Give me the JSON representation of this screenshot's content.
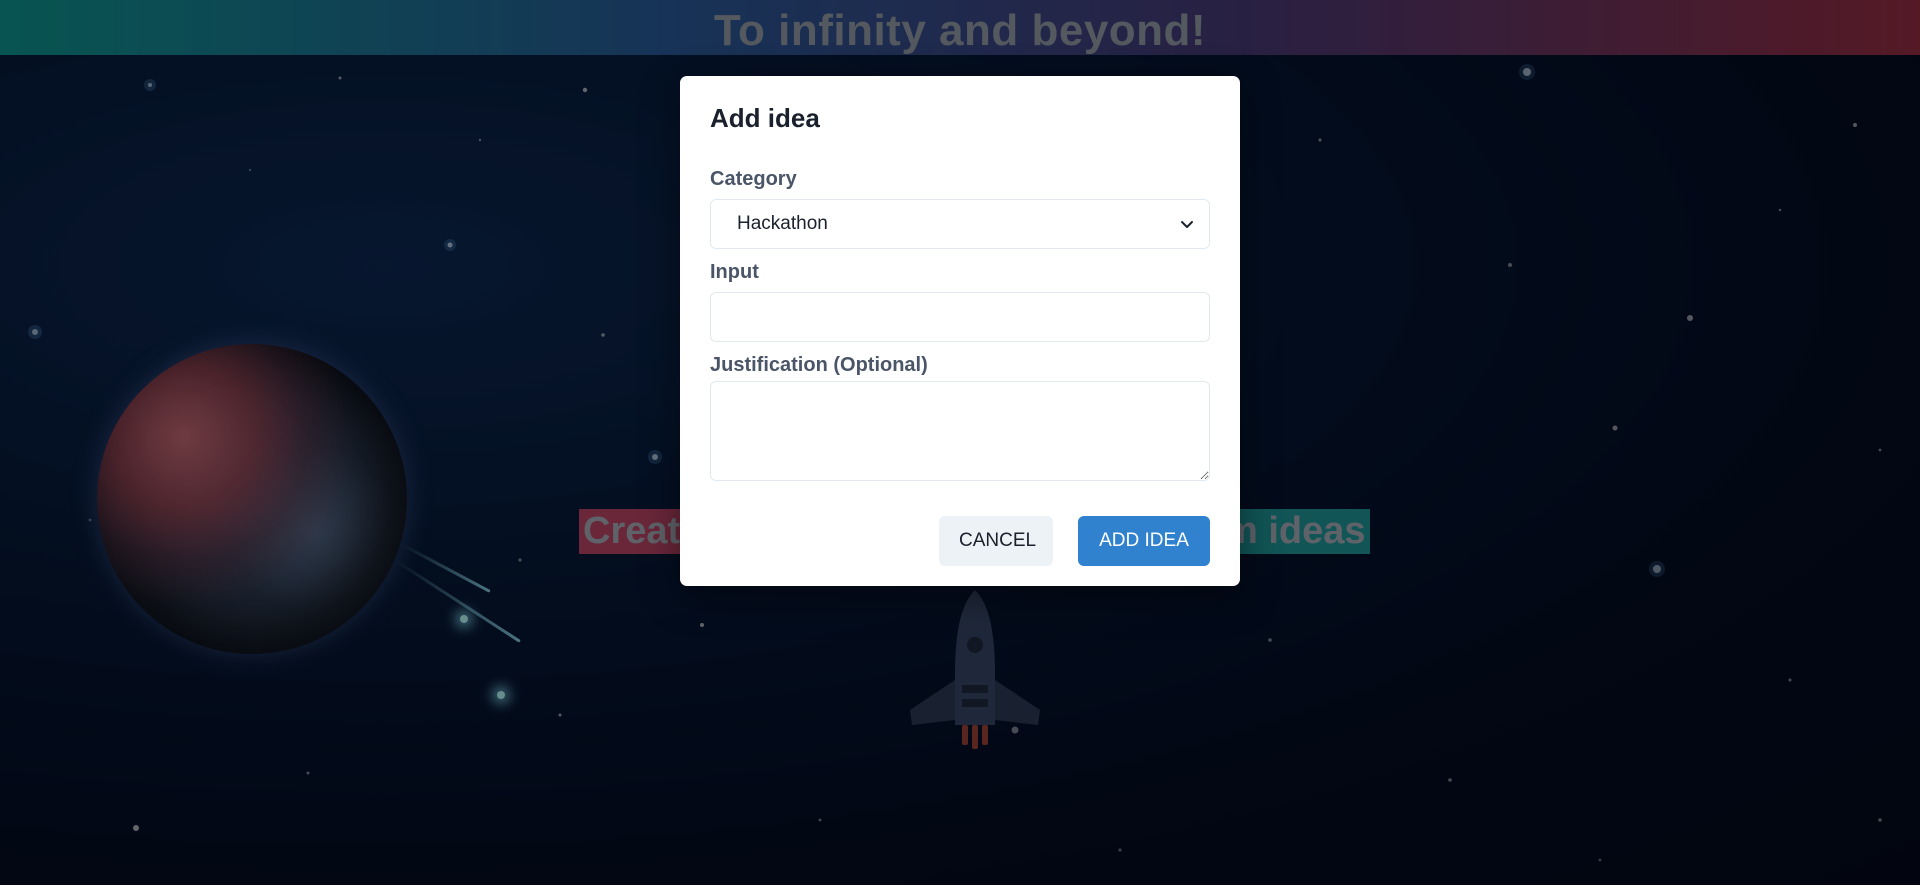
{
  "header": {
    "title": "To infinity and beyond!"
  },
  "tagline": {
    "left_visible": "Create",
    "right_visible": "m ideas"
  },
  "modal": {
    "title": "Add idea",
    "category": {
      "label": "Category",
      "selected": "Hackathon"
    },
    "input": {
      "label": "Input",
      "value": ""
    },
    "justification": {
      "label": "Justification (Optional)",
      "value": ""
    },
    "buttons": {
      "cancel": "CANCEL",
      "add": "ADD IDEA"
    }
  },
  "colors": {
    "header_gradient_start": "#0f9a95",
    "header_gradient_end": "#9b2f44",
    "primary_button": "#3182ce",
    "secondary_button": "#edf2f7",
    "tag_left": "#c1486b",
    "tag_right": "#1f9c9e"
  },
  "icons": {
    "select": "chevron-down-icon",
    "textarea": "resize-handle-icon"
  }
}
